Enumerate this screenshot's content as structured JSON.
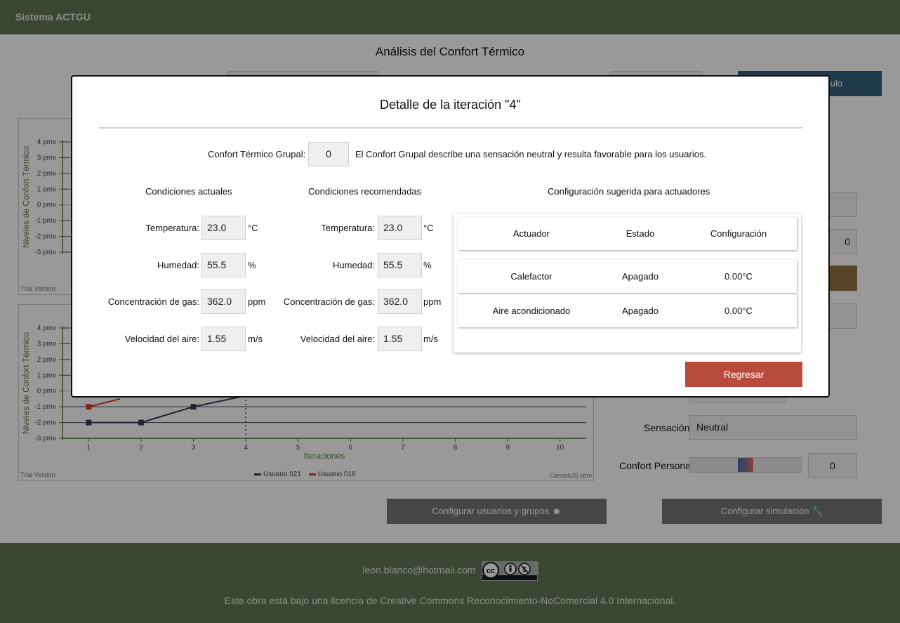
{
  "navbar": {
    "brand": "Sistema ACTGU"
  },
  "page": {
    "title": "Análisis del Confort Térmico",
    "calc_button_label": "ulo",
    "field_value_right": "0",
    "sensacion_label": "Sensación:",
    "sensacion_value": "Neutral",
    "confort_personal_label": "Confort Personal:",
    "confort_personal_value": "0",
    "configure_users_button": "Configurar usuarios y grupos",
    "configure_sim_button": "Configurar simulación"
  },
  "chart_data": [
    {
      "type": "line",
      "title": "",
      "xlabel": "",
      "ylabel": "Niveles de Confort Térmico",
      "y_ticks": [
        "4 pmv",
        "3 pmv",
        "2 pmv",
        "1 pmv",
        "0 pmv",
        "-1 pmv",
        "-2 pmv",
        "-3 pmv"
      ],
      "ylim": [
        -3,
        4
      ],
      "watermark": "Trial Version"
    },
    {
      "type": "line",
      "title": "",
      "xlabel": "Iteraciones",
      "ylabel": "Niveles de Confort Térmico",
      "y_ticks": [
        "4 pmv",
        "3 pmv",
        "2 pmv",
        "1 pmv",
        "0 pmv",
        "-1 pmv",
        "-2 pmv",
        "-3 pmv"
      ],
      "x_ticks": [
        "1",
        "2",
        "3",
        "4",
        "5",
        "6",
        "7",
        "8",
        "9",
        "10"
      ],
      "ylim": [
        -3,
        4
      ],
      "xlim": [
        0.5,
        10.5
      ],
      "selected_iteration": 4,
      "series": [
        {
          "name": "Usuario 021",
          "color": "#3a3a52",
          "x": [
            1,
            2,
            3,
            4
          ],
          "y": [
            -2,
            -2,
            -1,
            -0.3
          ]
        },
        {
          "name": "Usuario 018",
          "color": "#d33b2f",
          "x": [
            1,
            1.6
          ],
          "y": [
            -1,
            -0.5
          ]
        }
      ],
      "watermark": "Trial Version",
      "credit": "CanvasJS.com"
    }
  ],
  "modal": {
    "title": "Detalle de la iteración \"4\"",
    "group_comfort_label": "Confort Térmico Grupal:",
    "group_comfort_value": "0",
    "group_comfort_description": "El Confort Grupal describe una sensación neutral y resulta favorable para los usuarios.",
    "current": {
      "heading": "Condiciones actuales",
      "temp_label": "Temperatura:",
      "temp_value": "23.0",
      "temp_unit": "°C",
      "hum_label": "Humedad:",
      "hum_value": "55.5",
      "hum_unit": "%",
      "gas_label": "Concentración de gas:",
      "gas_value": "362.0",
      "gas_unit": "ppm",
      "air_label": "Velocidad del aire:",
      "air_value": "1.55",
      "air_unit": "m/s"
    },
    "recommended": {
      "heading": "Condiciones recomendadas",
      "temp_label": "Temperatura:",
      "temp_value": "23.0",
      "temp_unit": "°C",
      "hum_label": "Humedad:",
      "hum_value": "55.5",
      "hum_unit": "%",
      "gas_label": "Concentración de gas:",
      "gas_value": "362.0",
      "gas_unit": "ppm",
      "air_label": "Velocidad del aire:",
      "air_value": "1.55",
      "air_unit": "m/s"
    },
    "actuators": {
      "heading": "Configuración sugerida para actuadores",
      "columns": [
        "Actuador",
        "Estado",
        "Configuración"
      ],
      "rows": [
        [
          "Calefactor",
          "Apagado",
          "0.00°C"
        ],
        [
          "Aire acondicionado",
          "Apagado",
          "0.00°C"
        ]
      ]
    },
    "back_button": "Regresar"
  },
  "footer": {
    "email": "leon.blanco@hotmail.com",
    "license": "Este obra está bajo una licencia de Creative Commons Reconocimiento-NoComercial 4.0 Internacional."
  }
}
